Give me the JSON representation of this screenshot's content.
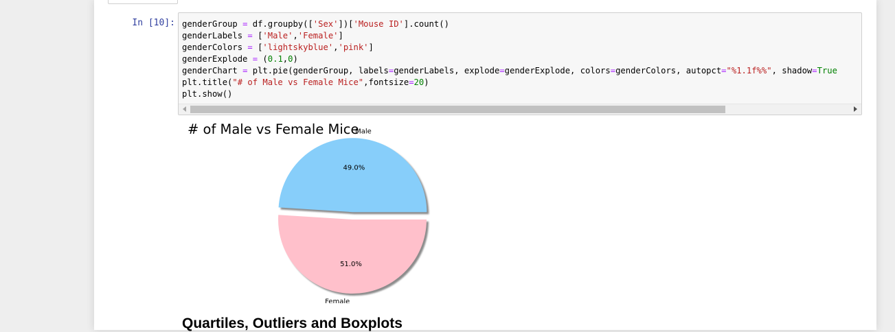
{
  "cell": {
    "prompt": "In [10]:",
    "code_lines": [
      [
        {
          "t": "genderGroup ",
          "c": ""
        },
        {
          "t": "=",
          "c": "cm-op"
        },
        {
          "t": " df.groupby([",
          "c": ""
        },
        {
          "t": "'Sex'",
          "c": "cm-str"
        },
        {
          "t": "])[",
          "c": ""
        },
        {
          "t": "'Mouse ID'",
          "c": "cm-str"
        },
        {
          "t": "].count()",
          "c": ""
        }
      ],
      [
        {
          "t": "genderLabels ",
          "c": ""
        },
        {
          "t": "=",
          "c": "cm-op"
        },
        {
          "t": " [",
          "c": ""
        },
        {
          "t": "'Male'",
          "c": "cm-str"
        },
        {
          "t": ",",
          "c": ""
        },
        {
          "t": "'Female'",
          "c": "cm-str"
        },
        {
          "t": "]",
          "c": ""
        }
      ],
      [
        {
          "t": "genderColors ",
          "c": ""
        },
        {
          "t": "=",
          "c": "cm-op"
        },
        {
          "t": " [",
          "c": ""
        },
        {
          "t": "'lightskyblue'",
          "c": "cm-str"
        },
        {
          "t": ",",
          "c": ""
        },
        {
          "t": "'pink'",
          "c": "cm-str"
        },
        {
          "t": "]",
          "c": ""
        }
      ],
      [
        {
          "t": "genderExplode ",
          "c": ""
        },
        {
          "t": "=",
          "c": "cm-op"
        },
        {
          "t": " (",
          "c": ""
        },
        {
          "t": "0.1",
          "c": "cm-num"
        },
        {
          "t": ",",
          "c": ""
        },
        {
          "t": "0",
          "c": "cm-num"
        },
        {
          "t": ")",
          "c": ""
        }
      ],
      [
        {
          "t": "genderChart ",
          "c": ""
        },
        {
          "t": "=",
          "c": "cm-op"
        },
        {
          "t": " plt.pie(genderGroup, labels",
          "c": ""
        },
        {
          "t": "=",
          "c": "cm-op"
        },
        {
          "t": "genderLabels, explode",
          "c": ""
        },
        {
          "t": "=",
          "c": "cm-op"
        },
        {
          "t": "genderExplode, colors",
          "c": ""
        },
        {
          "t": "=",
          "c": "cm-op"
        },
        {
          "t": "genderColors, autopct",
          "c": ""
        },
        {
          "t": "=",
          "c": "cm-op"
        },
        {
          "t": "\"%1.1f%%\"",
          "c": "cm-str"
        },
        {
          "t": ", shadow",
          "c": ""
        },
        {
          "t": "=",
          "c": "cm-op"
        },
        {
          "t": "True",
          "c": "cm-num"
        }
      ],
      [
        {
          "t": "plt.title(",
          "c": ""
        },
        {
          "t": "\"# of Male vs Female Mice\"",
          "c": "cm-str"
        },
        {
          "t": ",fontsize",
          "c": ""
        },
        {
          "t": "=",
          "c": "cm-op"
        },
        {
          "t": "20",
          "c": "cm-num"
        },
        {
          "t": ")",
          "c": ""
        }
      ],
      [
        {
          "t": "plt.show()",
          "c": ""
        }
      ]
    ]
  },
  "chart_data": {
    "type": "pie",
    "title": "# of Male vs Female Mice",
    "categories": [
      "Male",
      "Female"
    ],
    "values": [
      49.0,
      51.0
    ],
    "value_labels": [
      "49.0%",
      "51.0%"
    ],
    "colors": [
      "#87cefa",
      "#ffc0cb"
    ],
    "explode": [
      0.1,
      0
    ],
    "shadow": true
  },
  "next_heading": "Quartiles, Outliers and Boxplots"
}
